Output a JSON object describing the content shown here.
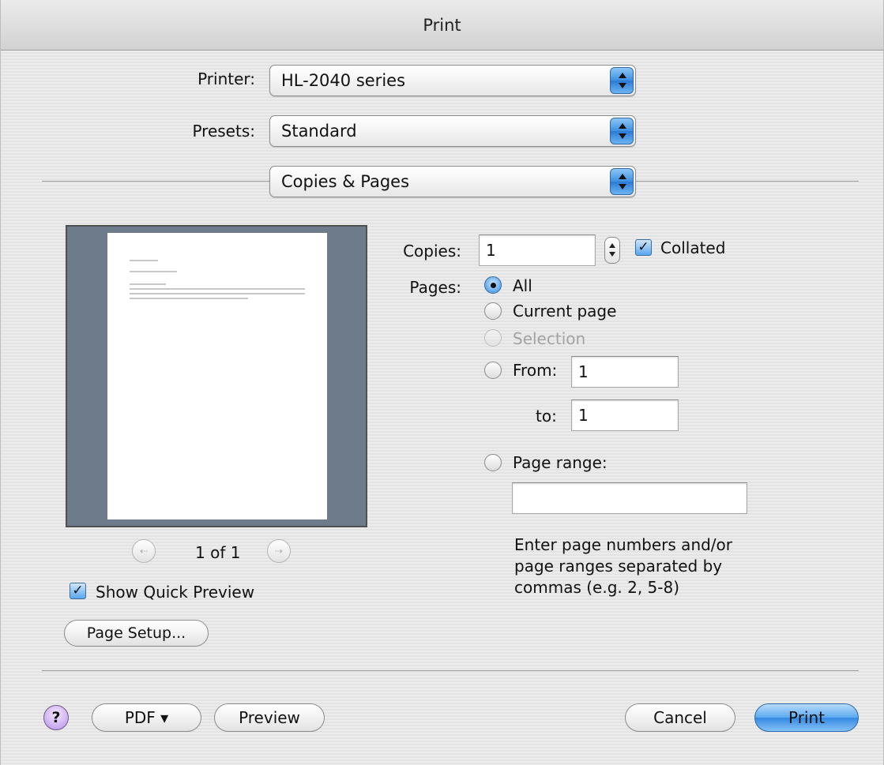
{
  "window": {
    "title": "Print"
  },
  "printer": {
    "label": "Printer:",
    "value": "HL-2040 series"
  },
  "presets": {
    "label": "Presets:",
    "value": "Standard"
  },
  "panel": {
    "value": "Copies & Pages"
  },
  "preview": {
    "page_indicator": "1 of 1",
    "show_quick_preview_label": "Show Quick Preview",
    "show_quick_preview_checked": true
  },
  "page_setup_label": "Page Setup...",
  "copies": {
    "label": "Copies:",
    "value": "1",
    "collated_label": "Collated",
    "collated_checked": true
  },
  "pages": {
    "label": "Pages:",
    "all_label": "All",
    "current_label": "Current page",
    "selection_label": "Selection",
    "from_label": "From:",
    "from_value": "1",
    "to_label": "to:",
    "to_value": "1",
    "range_label": "Page range:",
    "range_value": "",
    "selected": "All",
    "help_line1": "Enter page numbers and/or",
    "help_line2": "page ranges separated by",
    "help_line3": "commas (e.g. 2, 5-8)"
  },
  "buttons": {
    "help": "?",
    "pdf": "PDF ▾",
    "preview": "Preview",
    "cancel": "Cancel",
    "print": "Print"
  },
  "icons": {
    "check": "✓",
    "prev": "⇠",
    "next": "⇢"
  },
  "colors": {
    "accent_blue": "#3488e2",
    "preview_bg": "#6e7b8b",
    "help_purple": "#c7a6ef"
  }
}
